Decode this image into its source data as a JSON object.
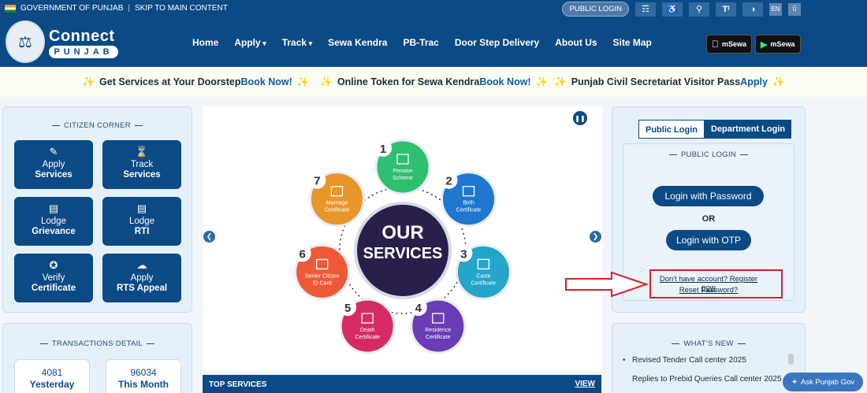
{
  "topbar": {
    "gov_label": "GOVERNMENT OF PUNJAB",
    "skip_label": "SKIP TO MAIN CONTENT",
    "public_login_label": "PUBLIC LOGIN",
    "icons": [
      "sitemap-icon",
      "accessibility-icon",
      "search-icon",
      "text-size-icon",
      "contrast-icon"
    ],
    "lang_en": "EN",
    "lang_pa": "ਪੰ"
  },
  "header": {
    "brand_line1": "Connect",
    "brand_line2": "PUNJAB",
    "nav": [
      {
        "label": "Home",
        "dropdown": false
      },
      {
        "label": "Apply",
        "dropdown": true
      },
      {
        "label": "Track",
        "dropdown": true
      },
      {
        "label": "Sewa Kendra",
        "dropdown": false
      },
      {
        "label": "PB-Trac",
        "dropdown": false
      },
      {
        "label": "Door Step Delivery",
        "dropdown": false
      },
      {
        "label": "About Us",
        "dropdown": false
      },
      {
        "label": "Site Map",
        "dropdown": false
      }
    ],
    "app_store_label": "mSewa",
    "play_store_label": "mSewa"
  },
  "ribbon": {
    "item1_text": "Get Services at Your Doorstep ",
    "item1_link": "Book Now!",
    "item2_text": "Online Token for Sewa Kendra ",
    "item2_link": "Book Now!",
    "item3_text": "Punjab Civil Secretariat Visitor Pass ",
    "item3_link": "Apply"
  },
  "citizen_corner": {
    "title": "CITIZEN CORNER",
    "tiles": [
      {
        "line1": "Apply",
        "line2": "Services",
        "icon": "edit-icon"
      },
      {
        "line1": "Track",
        "line2": "Services",
        "icon": "hourglass-icon"
      },
      {
        "line1": "Lodge",
        "line2": "Grievance",
        "icon": "inbox-icon"
      },
      {
        "line1": "Lodge",
        "line2": "RTI",
        "icon": "inbox-icon"
      },
      {
        "line1": "Verify",
        "line2": "Certificate",
        "icon": "badge-icon"
      },
      {
        "line1": "Apply",
        "line2": "RTS Appeal",
        "icon": "cloud-upload-icon"
      }
    ]
  },
  "transactions": {
    "title": "TRANSACTIONS DETAIL",
    "yesterday_value": "4081",
    "yesterday_label": "Yesterday",
    "month_value": "96034",
    "month_label": "This Month"
  },
  "services": {
    "center_line1": "OUR",
    "center_line2": "SERVICES",
    "items": [
      {
        "num": "1",
        "line1": "Pension",
        "line2": "Scheme",
        "color": "#2fbf71"
      },
      {
        "num": "2",
        "line1": "Birth",
        "line2": "Certificate",
        "color": "#1f77d0"
      },
      {
        "num": "3",
        "line1": "Caste",
        "line2": "Certificate",
        "color": "#23a6c9"
      },
      {
        "num": "4",
        "line1": "Residence",
        "line2": "Certificate",
        "color": "#6a3cb5"
      },
      {
        "num": "5",
        "line1": "Death",
        "line2": "Certificate",
        "color": "#d62a63"
      },
      {
        "num": "6",
        "line1": "Senior Citizen",
        "line2": "ID Card",
        "color": "#ee5a38"
      },
      {
        "num": "7",
        "line1": "Marriage",
        "line2": "Certificate",
        "color": "#e8952a"
      }
    ]
  },
  "top_services": {
    "title": "TOP SERVICES",
    "view_label": "VIEW"
  },
  "login": {
    "tab_public": "Public Login",
    "tab_department": "Department Login",
    "title": "PUBLIC LOGIN",
    "password_button": "Login with Password",
    "or_label": "OR",
    "otp_button": "Login with OTP",
    "register_link": "Don't have account? Register now",
    "reset_link": "Reset Password?"
  },
  "whats_new": {
    "title": "WHAT'S NEW",
    "items": [
      "Revised Tender Call center 2025",
      "Replies to Prebid Queries Call center 2025"
    ]
  },
  "ask_button": "Ask Punjab Gov",
  "colors": {
    "primary": "#0b4a85",
    "highlight": "#d91e2a",
    "accent": "#f2b02c"
  }
}
